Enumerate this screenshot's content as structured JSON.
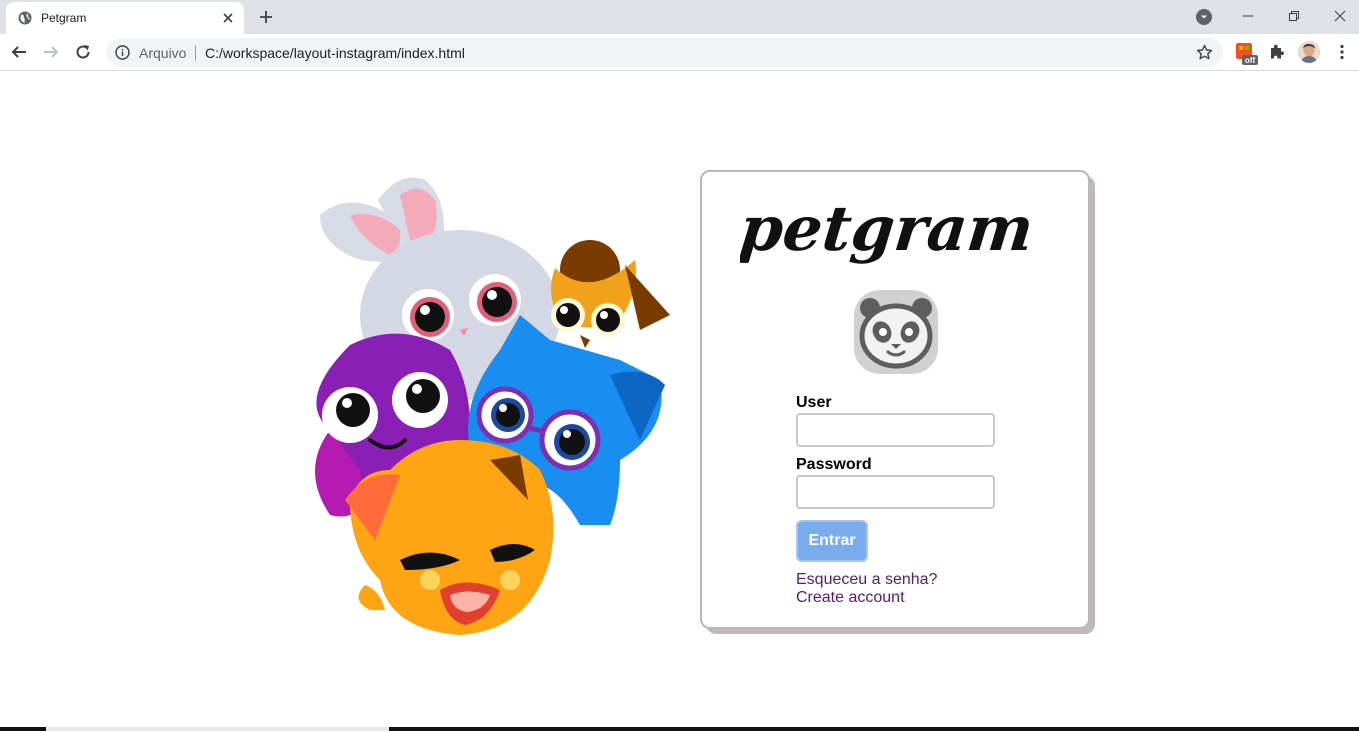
{
  "browser": {
    "tab_title": "Petgram",
    "address_scheme": "Arquivo",
    "address_url": "C:/workspace/layout-instagram/index.html",
    "extension_badge": "off"
  },
  "icons": {
    "favicon": "globe-icon",
    "tab_close": "close-icon",
    "new_tab": "plus-icon",
    "back": "arrow-left-icon",
    "forward": "arrow-right-icon",
    "reload": "reload-icon",
    "info": "info-icon",
    "bookmark": "star-icon",
    "extensions": "puzzle-icon",
    "menu": "kebab-menu-icon"
  },
  "login": {
    "logo_text": "petgram",
    "user_label": "User",
    "user_value": "",
    "password_label": "Password",
    "password_value": "",
    "submit_label": "Entrar",
    "forgot_link": "Esqueceu a senha?",
    "create_link": "Create account"
  },
  "colors": {
    "button": "#79acec",
    "link": "#5a1a6e",
    "card_shadow": "#c2b7bb"
  }
}
